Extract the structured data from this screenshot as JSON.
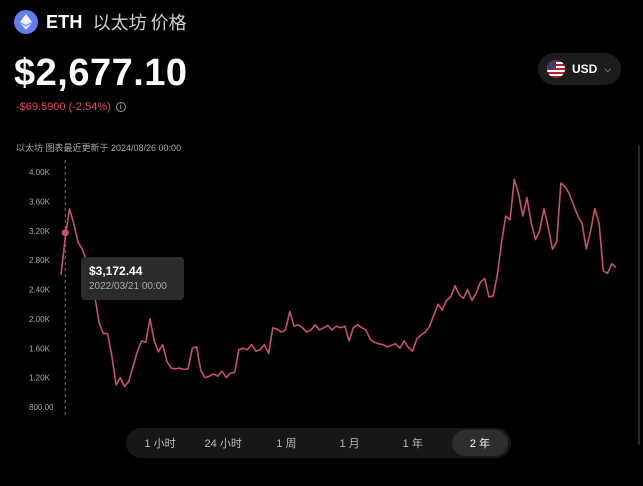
{
  "header": {
    "symbol": "ETH",
    "name": "以太坊",
    "suffix": "价格",
    "icon": "ethereum-icon"
  },
  "price": "$2,677.10",
  "change": "-$69.5900 (-2.54%)",
  "currency": {
    "label": "USD",
    "icon": "us-flag-icon"
  },
  "note": "以太坊 图表最近更新于 2024/08/26 00:00",
  "tooltip": {
    "price": "$3,172.44",
    "date": "2022/03/21 00:00"
  },
  "ranges": [
    "1 小时",
    "24 小时",
    "1 周",
    "1 月",
    "1 年",
    "2 年"
  ],
  "active_range": "2 年",
  "colors": {
    "line": "#c9506c",
    "negative": "#e0475f",
    "background": "#000000"
  },
  "chart_data": {
    "type": "line",
    "y_ticks": [
      "4.00K",
      "3.60K",
      "3.20K",
      "2.80K",
      "2.40K",
      "2.00K",
      "1.60K",
      "1.20K",
      "800.00"
    ],
    "ylim": [
      800,
      4000
    ],
    "x_start": "2022-02-27",
    "x_end": "2024-08-26",
    "series": [
      {
        "values": [
          2600,
          3100,
          3500,
          3300,
          3050,
          2950,
          2800,
          2550,
          2300,
          1950,
          1800,
          1800,
          1500,
          1100,
          1200,
          1080,
          1150,
          1350,
          1550,
          1700,
          1680,
          2000,
          1700,
          1550,
          1650,
          1420,
          1330,
          1320,
          1330,
          1310,
          1320,
          1600,
          1620,
          1300,
          1200,
          1220,
          1250,
          1220,
          1290,
          1200,
          1260,
          1270,
          1580,
          1600,
          1580,
          1650,
          1560,
          1580,
          1650,
          1530,
          1880,
          1860,
          1820,
          1850,
          2100,
          1900,
          1920,
          1880,
          1820,
          1850,
          1920,
          1850,
          1880,
          1910,
          1850,
          1900,
          1880,
          1900,
          1700,
          1880,
          1920,
          1880,
          1850,
          1720,
          1680,
          1660,
          1650,
          1620,
          1640,
          1660,
          1600,
          1700,
          1610,
          1560,
          1730,
          1780,
          1820,
          1900,
          2050,
          2200,
          2120,
          2250,
          2300,
          2450,
          2330,
          2280,
          2400,
          2250,
          2350,
          2500,
          2550,
          2300,
          2310,
          2600,
          3050,
          3400,
          3350,
          3900,
          3700,
          3400,
          3650,
          3300,
          3080,
          3200,
          3500,
          3250,
          2950,
          3050,
          3850,
          3800,
          3700,
          3550,
          3400,
          3300,
          2950,
          3200,
          3500,
          3300,
          2650,
          2620,
          2750,
          2700
        ]
      }
    ],
    "highlight": {
      "index": 1,
      "value": 3172.44,
      "label": "2022/03/21 00:00"
    },
    "grid": false
  }
}
